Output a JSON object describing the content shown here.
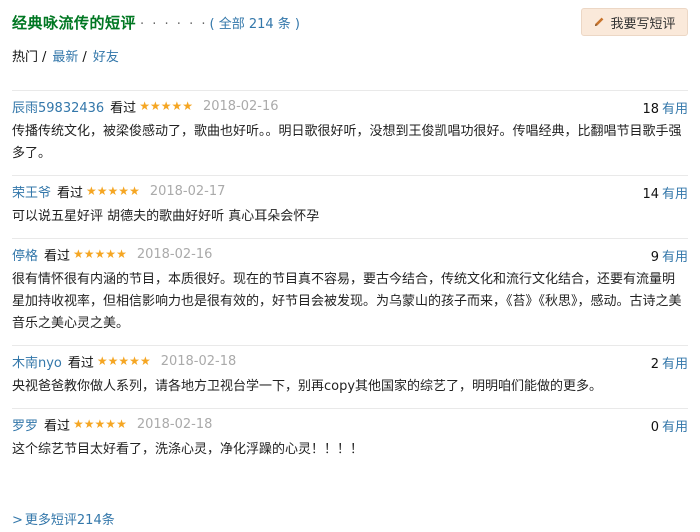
{
  "header": {
    "title": "经典咏流传的短评",
    "dots": "· · · · · ·",
    "count_link": "( 全部 214 条 )",
    "write_button": "我要写短评"
  },
  "tabs": [
    {
      "label": "热门",
      "current": true
    },
    {
      "label": "最新",
      "current": false
    },
    {
      "label": "好友",
      "current": false
    }
  ],
  "tab_separator": "/",
  "star_glyph": "★★★★★",
  "reviews": [
    {
      "user": "辰雨59832436",
      "status": "看过",
      "rating": 5,
      "date": "2018-02-16",
      "votes": "18",
      "votes_unit": "有用",
      "content": "传播传统文化，被梁俊感动了，歌曲也好听。。明日歌很好听，没想到王俊凯唱功很好。传唱经典，比翻唱节目歌手强多了。"
    },
    {
      "user": "荣王爷",
      "status": "看过",
      "rating": 5,
      "date": "2018-02-17",
      "votes": "14",
      "votes_unit": "有用",
      "content": "可以说五星好评 胡德夫的歌曲好好听 真心耳朵会怀孕"
    },
    {
      "user": "停格",
      "status": "看过",
      "rating": 5,
      "date": "2018-02-16",
      "votes": "9",
      "votes_unit": "有用",
      "content": "很有情怀很有内涵的节目，本质很好。现在的节目真不容易，要古今结合，传统文化和流行文化结合，还要有流量明星加持收视率，但相信影响力也是很有效的，好节目会被发现。为乌蒙山的孩子而来，《苔》《秋思》，感动。古诗之美音乐之美心灵之美。"
    },
    {
      "user": "木南nyo",
      "status": "看过",
      "rating": 5,
      "date": "2018-02-18",
      "votes": "2",
      "votes_unit": "有用",
      "content": "央视爸爸教你做人系列，请各地方卫视台学一下，别再copy其他国家的综艺了，明明咱们能做的更多。"
    },
    {
      "user": "罗罗",
      "status": "看过",
      "rating": 5,
      "date": "2018-02-18",
      "votes": "0",
      "votes_unit": "有用",
      "content": "这个综艺节目太好看了，洗涤心灵，净化浮躁的心灵！！！！"
    }
  ],
  "more_link": "更多短评214条",
  "colors": {
    "title_green": "#007722",
    "link_blue": "#3377aa",
    "star_orange": "#f5a623",
    "button_bg": "#fae9da"
  }
}
